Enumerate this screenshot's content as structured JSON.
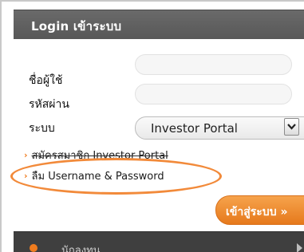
{
  "header": {
    "title": "Login เข้าระบบ"
  },
  "form": {
    "username_label": "ชื่อผู้ใช้",
    "password_label": "รหัสผ่าน",
    "system_label": "ระบบ",
    "system_selected": "Investor Portal"
  },
  "links": {
    "register": "สมัครสมาชิก Investor Portal",
    "forgot": "ลืม Username & Password"
  },
  "login_button": {
    "label": "เข้าสู่ระบบ »"
  },
  "bottom_bar": {
    "label": "นักลงทุน"
  },
  "colors": {
    "accent": "#f07c1e",
    "header_bg": "#5e5e5e",
    "bottom_bg": "#3f3f3f",
    "highlight_oval": "#f28a3a"
  },
  "icons": {
    "select_arrow": "chevron-down-icon",
    "link_bullet": "chevron-right-icon",
    "bottom_arrow": "triangle-right-icon"
  }
}
